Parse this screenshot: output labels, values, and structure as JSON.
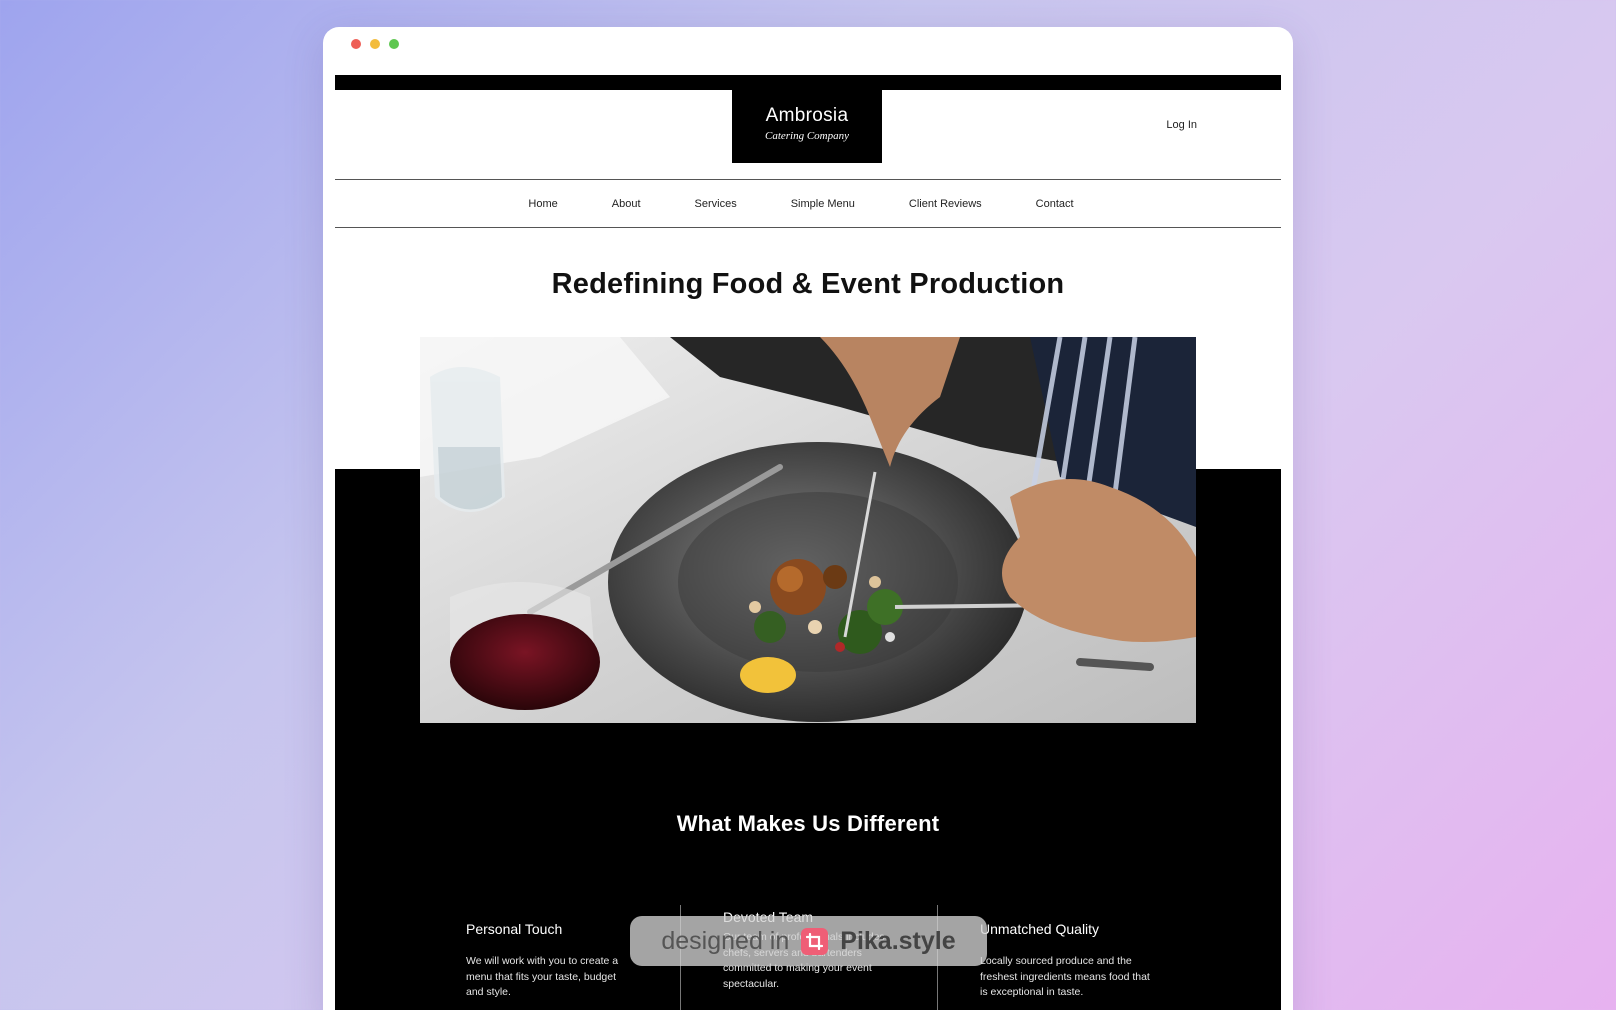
{
  "browser": {
    "controls": [
      "close",
      "minimize",
      "maximize"
    ]
  },
  "header": {
    "logo_name": "Ambrosia",
    "logo_tagline": "Catering Company",
    "login_label": "Log In"
  },
  "nav": {
    "items": [
      "Home",
      "About",
      "Services",
      "Simple Menu",
      "Client Reviews",
      "Contact"
    ]
  },
  "hero": {
    "title": "Redefining Food & Event Production"
  },
  "features": {
    "title": "What Makes Us Different",
    "items": [
      {
        "title": "Personal Touch",
        "text": "We will work with you to create a menu that fits your taste, budget and style."
      },
      {
        "title": "Devoted Team",
        "text": "Our team of professionals includes chefs, servers and bartenders committed to making your event spectacular."
      },
      {
        "title": "Unmatched Quality",
        "text": "Locally sourced produce and the freshest ingredients means food that is exceptional in taste."
      }
    ]
  },
  "watermark": {
    "prefix": "designed in",
    "brand": "Pika.style"
  },
  "colors": {
    "accent_black": "#000000",
    "background_gradient_start": "#9ea4ee",
    "background_gradient_end": "#e7b2f0",
    "watermark_icon": "#ef5e76"
  }
}
